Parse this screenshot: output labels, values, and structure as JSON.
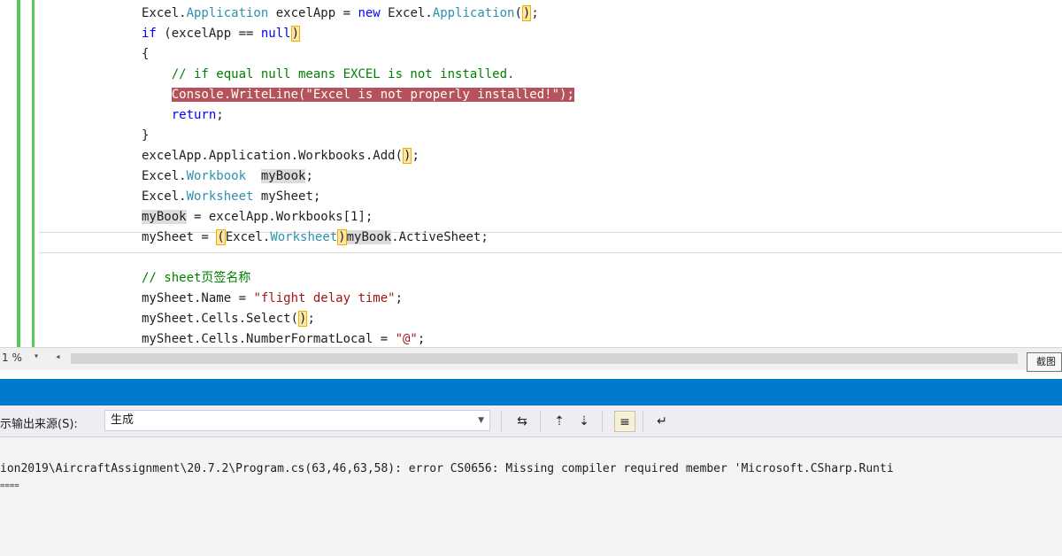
{
  "editor": {
    "lines": [
      [
        {
          "t": "Excel.",
          "c": ""
        },
        {
          "t": "Application",
          "c": "ty"
        },
        {
          "t": " excelApp = ",
          "c": ""
        },
        {
          "t": "new",
          "c": "kw"
        },
        {
          "t": " Excel.",
          "c": ""
        },
        {
          "t": "Application",
          "c": "ty"
        },
        {
          "t": "(",
          "c": ""
        },
        {
          "t": ")",
          "c": "brace"
        },
        {
          "t": ";",
          "c": ""
        }
      ],
      [
        {
          "t": "if",
          "c": "kw"
        },
        {
          "t": " (excelApp == ",
          "c": ""
        },
        {
          "t": "null",
          "c": "kw"
        },
        {
          "t": ")",
          "c": "brace"
        }
      ],
      [
        {
          "t": "{",
          "c": ""
        }
      ],
      [
        {
          "t": "    // if equal null means EXCEL is not installed.",
          "c": "cm"
        }
      ],
      [
        {
          "t": "    ",
          "c": ""
        },
        {
          "t": "Console.WriteLine(\"Excel is not properly installed!\");",
          "c": "err-line"
        }
      ],
      [
        {
          "t": "    ",
          "c": ""
        },
        {
          "t": "return",
          "c": "kw"
        },
        {
          "t": ";",
          "c": ""
        }
      ],
      [
        {
          "t": "}",
          "c": ""
        }
      ],
      [
        {
          "t": "excelApp.Application.Workbooks.Add(",
          "c": ""
        },
        {
          "t": ")",
          "c": "brace"
        },
        {
          "t": ";",
          "c": ""
        }
      ],
      [
        {
          "t": "Excel.",
          "c": ""
        },
        {
          "t": "Workbook",
          "c": "ty"
        },
        {
          "t": "  ",
          "c": ""
        },
        {
          "t": "myBook",
          "c": "hlw"
        },
        {
          "t": ";",
          "c": ""
        }
      ],
      [
        {
          "t": "Excel.",
          "c": ""
        },
        {
          "t": "Worksheet",
          "c": "ty"
        },
        {
          "t": " mySheet;",
          "c": ""
        }
      ],
      [
        {
          "t": "myBook",
          "c": "hlw"
        },
        {
          "t": " = excelApp.Workbooks[1];",
          "c": ""
        }
      ],
      [
        {
          "t": "mySheet = ",
          "c": ""
        },
        {
          "t": "(",
          "c": "brace"
        },
        {
          "t": "Excel.",
          "c": ""
        },
        {
          "t": "Worksheet",
          "c": "ty"
        },
        {
          "t": ")",
          "c": "brace"
        },
        {
          "t": "myBook",
          "c": "hlw"
        },
        {
          "t": ".ActiveSheet;",
          "c": ""
        }
      ],
      [
        {
          "t": "",
          "c": ""
        }
      ],
      [
        {
          "t": "// sheet页签名称",
          "c": "cm"
        }
      ],
      [
        {
          "t": "mySheet.Name = ",
          "c": ""
        },
        {
          "t": "\"flight delay time\"",
          "c": "st"
        },
        {
          "t": ";",
          "c": ""
        }
      ],
      [
        {
          "t": "mySheet.Cells.Select(",
          "c": ""
        },
        {
          "t": ")",
          "c": "brace"
        },
        {
          "t": ";",
          "c": ""
        }
      ],
      [
        {
          "t": "mySheet.Cells.NumberFormatLocal = ",
          "c": ""
        },
        {
          "t": "\"@\"",
          "c": "st"
        },
        {
          "t": ";",
          "c": ""
        }
      ]
    ]
  },
  "statusbar": {
    "zoom": "1 %",
    "tooltip": "截图"
  },
  "output_panel": {
    "source_label": "示输出来源(S):",
    "source_value": "生成",
    "lines": [
      "ion2019\\AircraftAssignment\\20.7.2\\Program.cs(63,46,63,58): error CS0656: Missing compiler required member 'Microsoft.CSharp.Runti",
      "===="
    ]
  },
  "colors": {
    "panel_accent": "#007acc",
    "error_highlight": "#b5525b",
    "change_bar": "#57c957"
  }
}
